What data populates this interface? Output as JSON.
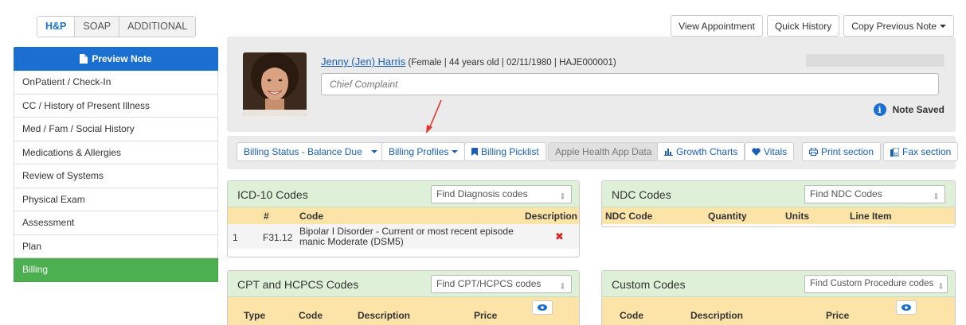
{
  "tabs": [
    "H&P",
    "SOAP",
    "ADDITIONAL"
  ],
  "sidebar": {
    "preview_label": "Preview Note",
    "items": [
      "OnPatient / Check-In",
      "CC / History of Present Illness",
      "Med / Fam / Social History",
      "Medications & Allergies",
      "Review of Systems",
      "Physical Exam",
      "Assessment",
      "Plan",
      "Billing"
    ],
    "active": "Billing"
  },
  "top_actions": {
    "view_appointment": "View Appointment",
    "quick_history": "Quick History",
    "copy_previous": "Copy Previous Note"
  },
  "patient": {
    "name": "Jenny (Jen) Harris",
    "details": "(Female | 44 years old | 02/11/1980 | HAJE000001)",
    "chief_complaint_placeholder": "Chief Complaint",
    "note_status": "Note Saved"
  },
  "billing_toolbar": {
    "billing_status": "Billing Status - Balance Due",
    "billing_profiles": "Billing Profiles",
    "billing_picklist": "Billing Picklist",
    "apple_health": "Apple Health App Data",
    "growth_charts": "Growth Charts",
    "vitals": "Vitals",
    "print_section": "Print section",
    "fax_section": "Fax section"
  },
  "icd10": {
    "title": "ICD-10 Codes",
    "find_placeholder": "Find Diagnosis codes",
    "columns": {
      "num": "#",
      "code": "Code",
      "description": "Description"
    },
    "rows": [
      {
        "index": "1",
        "code": "F31.12",
        "description_line1": "Bipolar I Disorder - Current or most recent episode",
        "description_line2": "manic Moderate (DSM5)"
      }
    ]
  },
  "ndc": {
    "title": "NDC Codes",
    "find_placeholder": "Find NDC Codes",
    "columns": {
      "ndc_code": "NDC Code",
      "quantity": "Quantity",
      "units": "Units",
      "line_item": "Line Item"
    }
  },
  "cpt": {
    "title": "CPT and HCPCS Codes",
    "find_placeholder": "Find CPT/HCPCS codes",
    "columns": {
      "type": "Type",
      "code": "Code",
      "description": "Description",
      "price": "Price"
    }
  },
  "custom": {
    "title": "Custom Codes",
    "find_placeholder": "Find Custom Procedure codes",
    "columns": {
      "code": "Code",
      "description": "Description",
      "price": "Price"
    }
  },
  "colors": {
    "primary_blue": "#1a6fd0",
    "active_green": "#4caf50",
    "panel_header_green": "#dff0d8",
    "column_header_yellow": "#fce3a8",
    "annotation_arrow": "#e5352b"
  }
}
